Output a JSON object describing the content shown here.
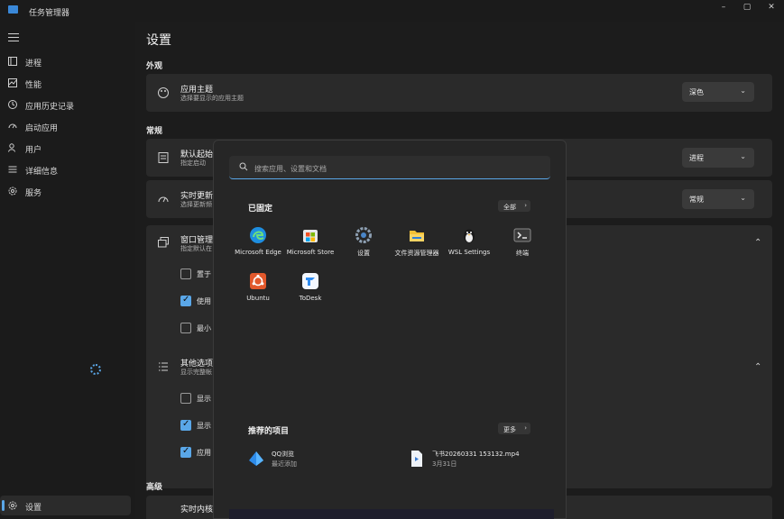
{
  "window": {
    "title": "任务管理器",
    "min": "–",
    "max": "▢",
    "close": "✕"
  },
  "sidebar": {
    "items": [
      {
        "label": "进程"
      },
      {
        "label": "性能"
      },
      {
        "label": "应用历史记录"
      },
      {
        "label": "启动应用"
      },
      {
        "label": "用户"
      },
      {
        "label": "详细信息"
      },
      {
        "label": "服务"
      }
    ],
    "settings_label": "设置"
  },
  "settings": {
    "title": "设置",
    "sections": {
      "appearance": "外观",
      "general": "常规",
      "advanced": "高级"
    },
    "theme": {
      "title": "应用主题",
      "subtitle": "选择要显示的应用主题",
      "value": "深色"
    },
    "default_page": {
      "title": "默认起始",
      "subtitle": "指定启动",
      "value": "进程"
    },
    "update_speed": {
      "title": "实时更新",
      "subtitle": "选择更新频",
      "value": "常规"
    },
    "window_mgmt": {
      "title": "窗口管理",
      "subtitle": "指定默认在",
      "options": [
        {
          "label": "置于",
          "checked": false
        },
        {
          "label": "使用",
          "checked": true
        },
        {
          "label": "最小",
          "checked": false
        }
      ]
    },
    "other": {
      "title": "其他选项",
      "subtitle": "显示完整帐",
      "options": [
        {
          "label": "显示",
          "checked": false
        },
        {
          "label": "显示",
          "checked": true
        },
        {
          "label": "应用",
          "checked": true
        }
      ]
    },
    "kernel": {
      "title": "实时内核"
    },
    "chevron_down": "⌄",
    "chevron_up": "⌃"
  },
  "start_menu": {
    "search_placeholder": "搜索应用、设置和文档",
    "pinned_title": "已固定",
    "all_button": "全部",
    "recommended_title": "推荐的项目",
    "more_button": "更多",
    "arrow": "›",
    "pinned_apps": [
      {
        "label": "Microsoft Edge",
        "icon": "edge-icon",
        "color": "#1e8ee0"
      },
      {
        "label": "Microsoft Store",
        "icon": "store-icon",
        "color": "#e8e8e8"
      },
      {
        "label": "设置",
        "icon": "settings-gear-icon",
        "color": "#6f7f90"
      },
      {
        "label": "文件资源管理器",
        "icon": "folder-icon",
        "color": "#f2c036"
      },
      {
        "label": "WSL Settings",
        "icon": "penguin-icon",
        "color": "#2a2a2a"
      },
      {
        "label": "终端",
        "icon": "terminal-icon",
        "color": "#3a3a3a"
      },
      {
        "label": "Ubuntu",
        "icon": "ubuntu-icon",
        "color": "#e2582b"
      },
      {
        "label": "ToDesk",
        "icon": "todesk-icon",
        "color": "#2f8cf0"
      }
    ],
    "recommended": [
      {
        "title": "QQ浏览",
        "subtitle": "最近添加",
        "icon": "qq-browser-icon"
      },
      {
        "title": "飞书20260331 153132.mp4",
        "subtitle": "3月31日",
        "icon": "video-file-icon"
      }
    ]
  }
}
